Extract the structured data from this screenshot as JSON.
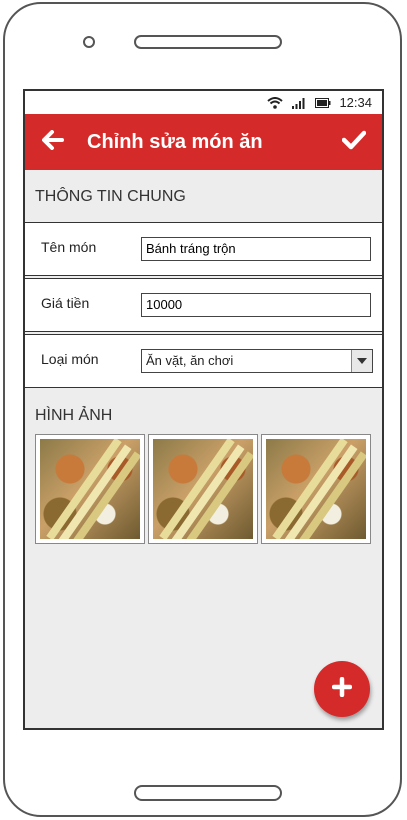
{
  "status_bar": {
    "time": "12:34"
  },
  "app_bar": {
    "title": "Chỉnh sửa món ăn"
  },
  "general_section": {
    "header": "THÔNG TIN CHUNG"
  },
  "form": {
    "name": {
      "label": "Tên món",
      "value": "Bánh tráng trộn"
    },
    "price": {
      "label": "Giá tiền",
      "value": "10000"
    },
    "category": {
      "label": "Loại món",
      "selected": "Ăn vặt, ăn chơi"
    }
  },
  "images_section": {
    "header": "HÌNH ẢNH",
    "image_count": 3
  },
  "colors": {
    "accent": "#d42a2a",
    "background": "#ededed"
  },
  "icons": [
    "wifi-icon",
    "signal-icon",
    "battery-icon",
    "back-arrow-icon",
    "check-icon",
    "plus-icon"
  ]
}
